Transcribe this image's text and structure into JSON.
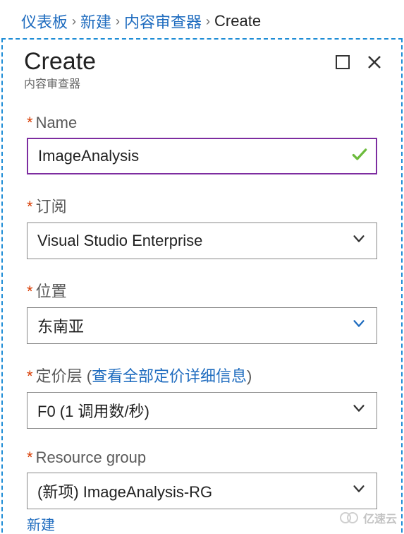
{
  "breadcrumb": {
    "items": [
      "仪表板",
      "新建",
      "内容审查器"
    ],
    "current": "Create"
  },
  "panel": {
    "title": "Create",
    "subtitle": "内容审查器"
  },
  "form": {
    "name": {
      "label": "Name",
      "value": "ImageAnalysis"
    },
    "subscription": {
      "label": "订阅",
      "value": "Visual Studio Enterprise"
    },
    "location": {
      "label": "位置",
      "value": "东南亚"
    },
    "pricing": {
      "label": "定价层",
      "link_text": "查看全部定价详细信息",
      "value": "F0 (1 调用数/秒)"
    },
    "resource_group": {
      "label": "Resource group",
      "value": "(新项) ImageAnalysis-RG",
      "new_link": "新建"
    }
  },
  "watermark": "亿速云"
}
